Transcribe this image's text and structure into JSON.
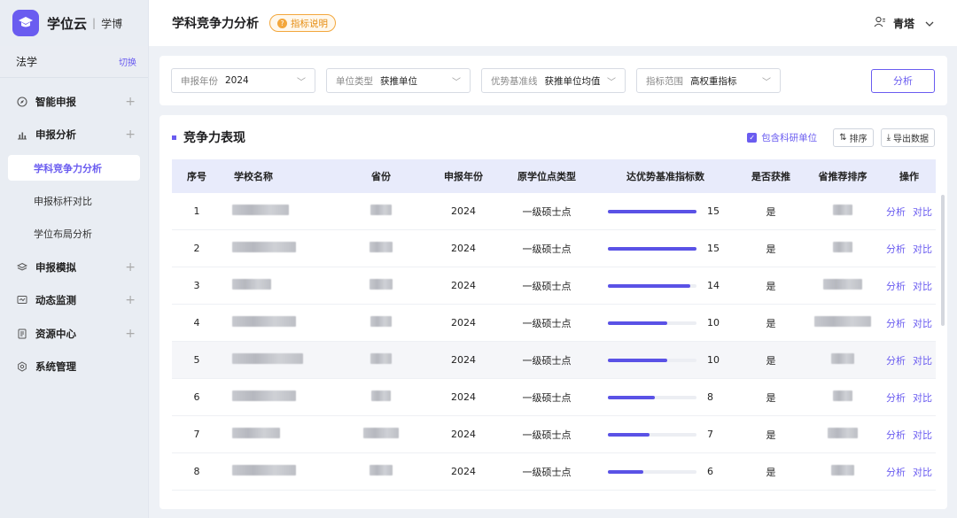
{
  "brand": {
    "name": "学位云",
    "sub": "学博"
  },
  "major": {
    "name": "法学",
    "switch_label": "切换"
  },
  "nav": {
    "smart_report": "智能申报",
    "report_analysis": "申报分析",
    "sub_competitiveness": "学科竞争力分析",
    "sub_benchmark": "申报标杆对比",
    "sub_layout": "学位布局分析",
    "report_sim": "申报模拟",
    "monitor": "动态监测",
    "resources": "资源中心",
    "system": "系统管理",
    "plus": "+"
  },
  "header": {
    "title": "学科竞争力分析",
    "info_badge": "指标说明",
    "user": "青塔"
  },
  "filters": [
    {
      "label": "申报年份",
      "value": "2024"
    },
    {
      "label": "单位类型",
      "value": "获推单位"
    },
    {
      "label": "优势基准线",
      "value": "获推单位均值"
    },
    {
      "label": "指标范围",
      "value": "高权重指标"
    }
  ],
  "analyze_label": "分析",
  "card": {
    "title": "竞争力表现",
    "include_label": "包含科研单位",
    "sort_label": "排序",
    "export_label": "导出数据"
  },
  "table": {
    "headers": {
      "idx": "序号",
      "name": "学校名称",
      "prov": "省份",
      "year": "申报年份",
      "type": "原学位点类型",
      "count": "达优势基准指标数",
      "won": "是否获推",
      "rank": "省推荐排序",
      "op": "操作"
    },
    "ops": {
      "analyze": "分析",
      "compare": "对比"
    },
    "max_count": 15,
    "rows": [
      {
        "idx": "1",
        "year": "2024",
        "type": "一级硕士点",
        "count": 15,
        "won": "是"
      },
      {
        "idx": "2",
        "year": "2024",
        "type": "一级硕士点",
        "count": 15,
        "won": "是"
      },
      {
        "idx": "3",
        "year": "2024",
        "type": "一级硕士点",
        "count": 14,
        "won": "是"
      },
      {
        "idx": "4",
        "year": "2024",
        "type": "一级硕士点",
        "count": 10,
        "won": "是"
      },
      {
        "idx": "5",
        "year": "2024",
        "type": "一级硕士点",
        "count": 10,
        "won": "是"
      },
      {
        "idx": "6",
        "year": "2024",
        "type": "一级硕士点",
        "count": 8,
        "won": "是"
      },
      {
        "idx": "7",
        "year": "2024",
        "type": "一级硕士点",
        "count": 7,
        "won": "是"
      },
      {
        "idx": "8",
        "year": "2024",
        "type": "一级硕士点",
        "count": 6,
        "won": "是"
      }
    ]
  }
}
